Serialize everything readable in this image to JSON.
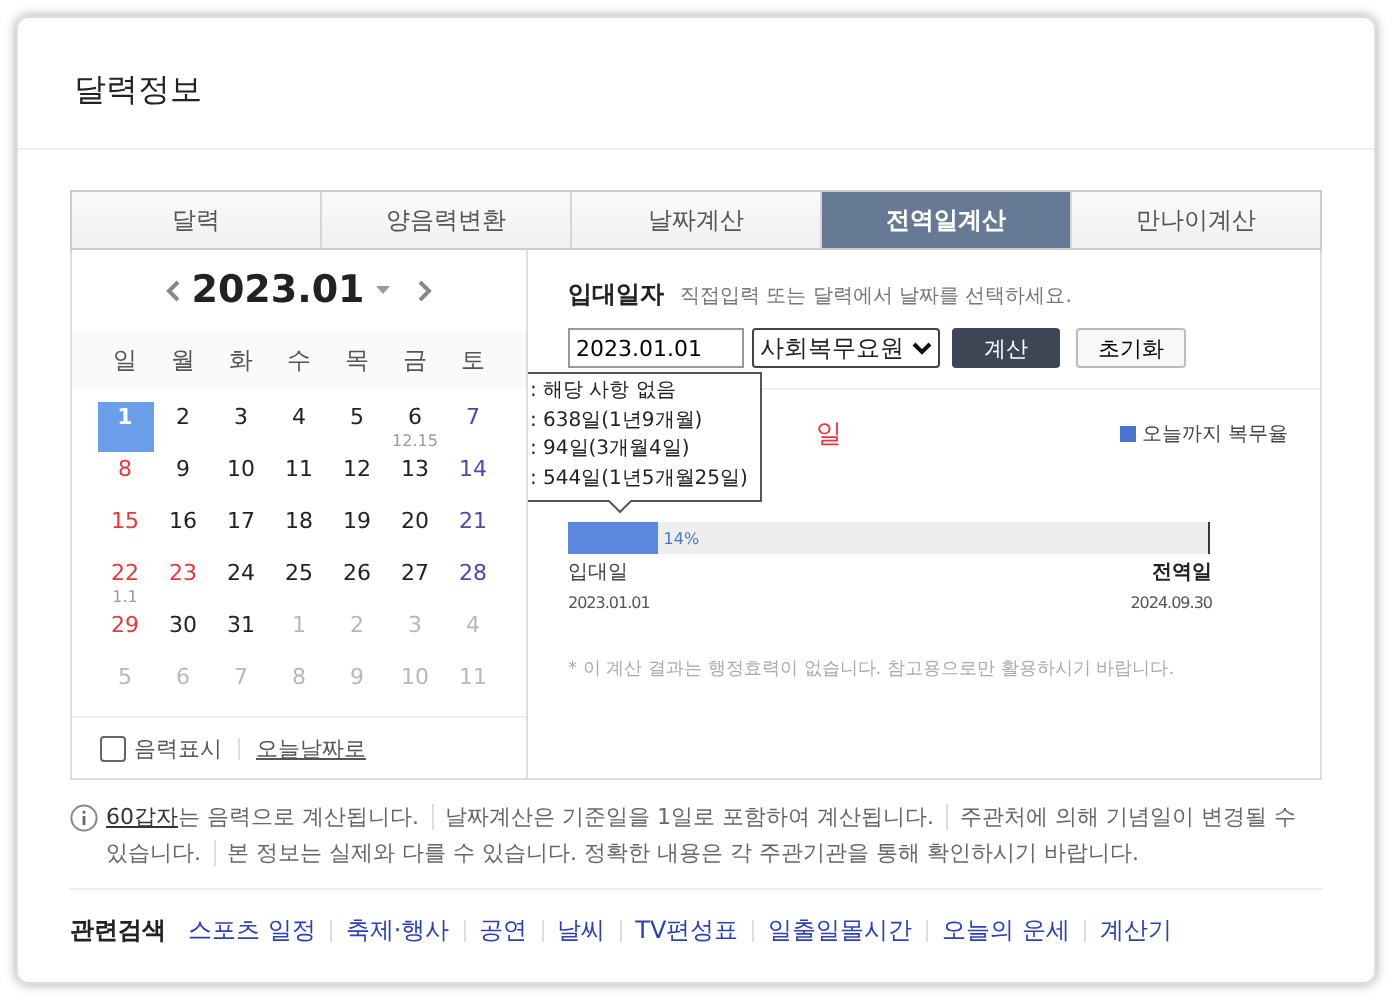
{
  "title": "달력정보",
  "tabs": [
    {
      "label": "달력",
      "selected": false
    },
    {
      "label": "양음력변환",
      "selected": false
    },
    {
      "label": "날짜계산",
      "selected": false
    },
    {
      "label": "전역일계산",
      "selected": true
    },
    {
      "label": "만나이계산",
      "selected": false
    }
  ],
  "calendar": {
    "month": "2023.01",
    "weekdays": [
      "일",
      "월",
      "화",
      "수",
      "목",
      "금",
      "토"
    ],
    "days": [
      {
        "day": "1",
        "selected": true
      },
      {
        "day": "2",
        "kind": "weekday",
        "selected": false
      },
      {
        "day": "3",
        "kind": "weekday",
        "selected": false
      },
      {
        "day": "4",
        "kind": "weekday",
        "selected": false
      },
      {
        "day": "5",
        "kind": "weekday",
        "selected": false
      },
      {
        "day": "6",
        "kind": "weekday",
        "selected": false,
        "lunar": "12.15"
      },
      {
        "day": "7",
        "kind": "saturday",
        "selected": false
      },
      {
        "day": "8",
        "kind": "sunday",
        "selected": false
      },
      {
        "day": "9",
        "kind": "weekday",
        "selected": false
      },
      {
        "day": "10",
        "kind": "weekday",
        "selected": false
      },
      {
        "day": "11",
        "kind": "weekday",
        "selected": false
      },
      {
        "day": "12",
        "kind": "weekday",
        "selected": false
      },
      {
        "day": "13",
        "kind": "weekday",
        "selected": false
      },
      {
        "day": "14",
        "kind": "saturday",
        "selected": false
      },
      {
        "day": "15",
        "kind": "sunday",
        "selected": false
      },
      {
        "day": "16",
        "kind": "weekday",
        "selected": false
      },
      {
        "day": "17",
        "kind": "weekday",
        "selected": false
      },
      {
        "day": "18",
        "kind": "weekday",
        "selected": false
      },
      {
        "day": "19",
        "kind": "weekday",
        "selected": false
      },
      {
        "day": "20",
        "kind": "weekday",
        "selected": false
      },
      {
        "day": "21",
        "kind": "saturday",
        "selected": false
      },
      {
        "day": "22",
        "kind": "sunday",
        "selected": false,
        "lunar": "1.1"
      },
      {
        "day": "23",
        "kind": "holiday",
        "selected": false
      },
      {
        "day": "24",
        "kind": "weekday",
        "selected": false
      },
      {
        "day": "25",
        "kind": "weekday",
        "selected": false
      },
      {
        "day": "26",
        "kind": "weekday",
        "selected": false
      },
      {
        "day": "27",
        "kind": "weekday",
        "selected": false
      },
      {
        "day": "28",
        "kind": "saturday",
        "selected": false
      },
      {
        "day": "29",
        "kind": "sunday",
        "selected": false
      },
      {
        "day": "30",
        "kind": "weekday",
        "selected": false
      },
      {
        "day": "31",
        "kind": "weekday",
        "selected": false
      },
      {
        "day": "1",
        "kind": "other",
        "selected": false
      },
      {
        "day": "2",
        "kind": "other",
        "selected": false
      },
      {
        "day": "3",
        "kind": "other",
        "selected": false
      },
      {
        "day": "4",
        "kind": "other",
        "selected": false
      },
      {
        "day": "5",
        "kind": "other",
        "selected": false
      },
      {
        "day": "6",
        "kind": "other",
        "selected": false
      },
      {
        "day": "7",
        "kind": "other",
        "selected": false
      },
      {
        "day": "8",
        "kind": "other",
        "selected": false
      },
      {
        "day": "9",
        "kind": "other",
        "selected": false
      },
      {
        "day": "10",
        "kind": "other",
        "selected": false
      },
      {
        "day": "11",
        "kind": "other",
        "selected": false
      }
    ],
    "lunar_toggle": {
      "label": "음력표시",
      "checked": false
    },
    "today_link": "오늘날짜로"
  },
  "form": {
    "label": "입대일자",
    "hint": "직접입력 또는 달력에서 날짜를 선택하세요.",
    "date": "2023.01.01",
    "service": "사회복무요원",
    "submit": "계산",
    "reset": "초기화"
  },
  "result": {
    "title_fragment": "일",
    "legend": "오늘까지 복무율",
    "level": 0.14,
    "percent": "14%",
    "start_label": "입대일",
    "start_date": "2023.01.01",
    "end_label": "전역일",
    "end_date": "2024.09.30",
    "note": "* 이 계산 결과는 행정효력이 없습니다. 참고용으로만 활용하시기 바랍니다."
  },
  "tooltip": [
    ": 해당 사항 없음",
    ": 638일(1년9개월)",
    ": 94일(3개월4일)",
    ": 544일(1년5개월25일)"
  ],
  "info": {
    "link": "60갑자",
    "items": [
      "는 음력으로 계산됩니다.",
      "날짜계산은 기준일을 1일로 포함하여 계산됩니다.",
      "주관처에 의해 기념일이 변경될 수 있습니다.",
      "본 정보는 실제와 다를 수 있습니다. 정확한 내용은 각 주관기관을 통해 확인하시기 바랍니다."
    ]
  },
  "related": {
    "label": "관련검색",
    "links": [
      "스포츠 일정",
      "축제·행사",
      "공연",
      "날씨",
      "TV편성표",
      "일출일몰시간",
      "오늘의 운세",
      "계산기"
    ]
  }
}
